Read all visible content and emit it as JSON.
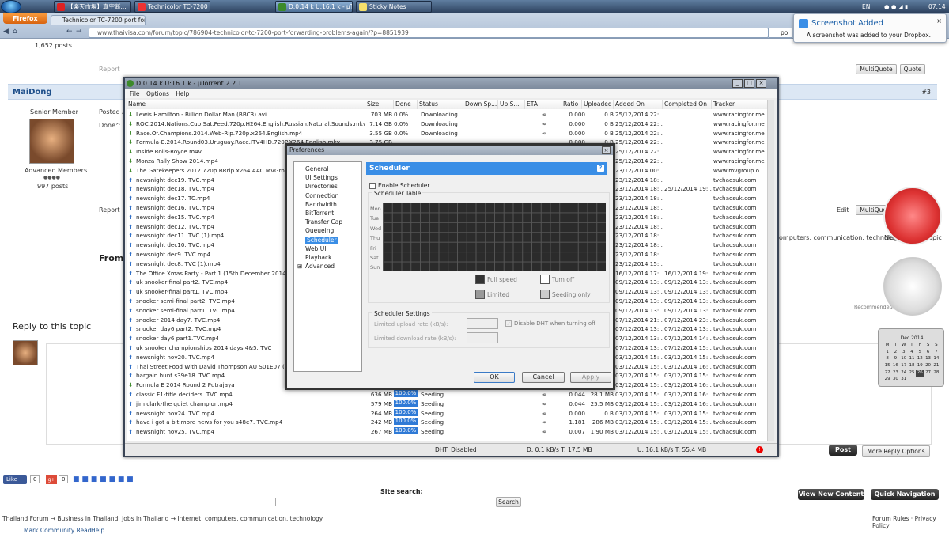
{
  "taskbar": {
    "tabs": [
      "【楽天市場】真空断...",
      "Technicolor TC-7200 ...",
      "D:0.14 k U:16.1 k - µT...",
      "Sticky Notes"
    ],
    "tray_lang": "EN",
    "tray_time": "07:14"
  },
  "browser": {
    "menu_label": "Firefox",
    "tab_title": "Technicolor TC-7200 port for...",
    "url": "www.thaivisa.com/forum/topic/786904-technicolor-tc-7200-port-forwarding-problems-again/?p=8851939",
    "search_hint": "po",
    "toast_title": "Screenshot Added",
    "toast_body": "A screenshot was added to your Dropbox."
  },
  "forum": {
    "posts_count_top": "1,652 posts",
    "report": "Report",
    "multiquote": "MultiQuote",
    "quote": "Quote",
    "author": "MaiDong",
    "post_number": "#3",
    "rank": "Senior Member",
    "posted_label": "Posted A",
    "post_text": "Done^.",
    "member_group": "Advanced Members",
    "posts_count": "997 posts",
    "edit": "Edit",
    "from_label": "From",
    "reply_heading": "Reply to this topic",
    "breadcrumb_right": "omputers, communication, technology",
    "next_unread": "Next Unread Topic",
    "recommended": "Recommended by",
    "post_btn": "Post",
    "more_reply": "More Reply Options",
    "like_label": "Like",
    "like_count": "0",
    "gplus_count": "0",
    "site_search": "Site search:",
    "search_btn": "Search",
    "view_new": "View New Content",
    "quick_nav": "Quick Navigation",
    "bc1": "Thailand Forum",
    "bc2": "Business in Thailand, Jobs in Thailand",
    "bc3": "Internet, computers, communication, technology",
    "forum_rules": "Forum Rules",
    "privacy": "Privacy Policy",
    "mark_read": "Mark Community Read",
    "help": "Help"
  },
  "utorrent": {
    "title": "D:0.14 k U:16.1 k - µTorrent 2.2.1",
    "menu": [
      "File",
      "Options",
      "Help"
    ],
    "columns": [
      "Name",
      "Size",
      "Done",
      "Status",
      "Down Sp...",
      "Up S...",
      "ETA",
      "Ratio",
      "Uploaded",
      "Added On",
      "Completed On",
      "Tracker"
    ],
    "rows": [
      {
        "t": "d",
        "name": "Lewis Hamilton - Billion Dollar Man (BBC3).avi",
        "size": "703 MB",
        "done": "0.0%",
        "status": "Downloading",
        "eta": "∞",
        "ratio": "0.000",
        "up": "0 B",
        "added": "25/12/2014 22:...",
        "comp": "",
        "tracker": "www.racingfor.me"
      },
      {
        "t": "d",
        "name": "ROC.2014.Nations.Cup.Sat.Feed.720p.H264.English.Russian.Natural.Sounds.mkv",
        "size": "7.14 GB",
        "done": "0.0%",
        "status": "Downloading",
        "eta": "∞",
        "ratio": "0.000",
        "up": "0 B",
        "added": "25/12/2014 22:...",
        "comp": "",
        "tracker": "www.racingfor.me"
      },
      {
        "t": "d",
        "name": "Race.Of.Champions.2014.Web-Rip.720p.x264.English.mp4",
        "size": "3.55 GB",
        "done": "0.0%",
        "status": "Downloading",
        "eta": "∞",
        "ratio": "0.000",
        "up": "0 B",
        "added": "25/12/2014 22:...",
        "comp": "",
        "tracker": "www.racingfor.me"
      },
      {
        "t": "d",
        "name": "Formula-E.2014.Round03.Uruguay.Race.ITV4HD.720P.X264.English.mkv",
        "size": "3.75 GB",
        "done": "",
        "status": "",
        "eta": "",
        "ratio": "0.000",
        "up": "0 B",
        "added": "25/12/2014 22:...",
        "comp": "",
        "tracker": "www.racingfor.me"
      },
      {
        "t": "d",
        "name": "Inside Rolls-Royce.m4v",
        "size": "",
        "done": "",
        "status": "",
        "eta": "",
        "ratio": "",
        "up": "",
        "added": "25/12/2014 22:...",
        "comp": "",
        "tracker": "www.racingfor.me"
      },
      {
        "t": "d",
        "name": "Monza Rally Show 2014.mp4",
        "size": "",
        "done": "",
        "status": "",
        "eta": "",
        "ratio": "",
        "up": "",
        "added": "25/12/2014 22:...",
        "comp": "",
        "tracker": "www.racingfor.me"
      },
      {
        "t": "d",
        "name": "The.Gatekeepers.2012.720p.BRrip.x264.AAC.MVGroup.or",
        "size": "",
        "done": "",
        "status": "",
        "eta": "",
        "ratio": "",
        "up": "",
        "added": "23/12/2014 00:...",
        "comp": "",
        "tracker": "www.mvgroup.o..."
      },
      {
        "t": "s",
        "name": "newsnight dec19. TVC.mp4",
        "size": "",
        "done": "",
        "status": "",
        "eta": "",
        "ratio": "",
        "up": "",
        "added": "23/12/2014 18:...",
        "comp": "",
        "tracker": "tvchaosuk.com"
      },
      {
        "t": "s",
        "name": "newsnight dec18. TVC.mp4",
        "size": "",
        "done": "",
        "status": "",
        "eta": "",
        "ratio": "",
        "up": "",
        "added": "23/12/2014 18:...",
        "comp": "25/12/2014 19:...",
        "tracker": "tvchaosuk.com"
      },
      {
        "t": "s",
        "name": "newsnight dec17. TC.mp4",
        "size": "",
        "done": "",
        "status": "",
        "eta": "",
        "ratio": "",
        "up": "",
        "added": "23/12/2014 18:...",
        "comp": "",
        "tracker": "tvchaosuk.com"
      },
      {
        "t": "s",
        "name": "newsnight dec16. TVC.mp4",
        "size": "",
        "done": "",
        "status": "",
        "eta": "",
        "ratio": "",
        "up": "",
        "added": "23/12/2014 18:...",
        "comp": "",
        "tracker": "tvchaosuk.com"
      },
      {
        "t": "s",
        "name": "newsnight dec15. TVC.mp4",
        "size": "",
        "done": "",
        "status": "",
        "eta": "",
        "ratio": "",
        "up": "",
        "added": "23/12/2014 18:...",
        "comp": "",
        "tracker": "tvchaosuk.com"
      },
      {
        "t": "s",
        "name": "newsnight dec12.  TVC.mp4",
        "size": "",
        "done": "",
        "status": "",
        "eta": "",
        "ratio": "",
        "up": "",
        "added": "23/12/2014 18:...",
        "comp": "",
        "tracker": "tvchaosuk.com"
      },
      {
        "t": "s",
        "name": "newsnight dec11. TVC (1).mp4",
        "size": "",
        "done": "",
        "status": "",
        "eta": "",
        "ratio": "",
        "up": "",
        "added": "23/12/2014 18:...",
        "comp": "",
        "tracker": "tvchaosuk.com"
      },
      {
        "t": "s",
        "name": "newsnight dec10. TVC.mp4",
        "size": "",
        "done": "",
        "status": "",
        "eta": "",
        "ratio": "",
        "up": "",
        "added": "23/12/2014 18:...",
        "comp": "",
        "tracker": "tvchaosuk.com"
      },
      {
        "t": "s",
        "name": "newsnight dec9. TVC.mp4",
        "size": "",
        "done": "",
        "status": "",
        "eta": "",
        "ratio": "",
        "up": "",
        "added": "23/12/2014 18:...",
        "comp": "",
        "tracker": "tvchaosuk.com"
      },
      {
        "t": "s",
        "name": "newsnight dec8. TVC (1).mp4",
        "size": "",
        "done": "",
        "status": "",
        "eta": "",
        "ratio": "",
        "up": "",
        "added": "23/12/2014 15:...",
        "comp": "",
        "tracker": "tvchaosuk.com"
      },
      {
        "t": "s",
        "name": "The Office Xmas Party - Part 1 (15th December 2014) [PD",
        "size": "",
        "done": "",
        "status": "",
        "eta": "",
        "ratio": "",
        "up": "",
        "added": "16/12/2014 17:...",
        "comp": "16/12/2014 19:...",
        "tracker": "tvchaosuk.com"
      },
      {
        "t": "s",
        "name": "uk snooker final part2. TVC.mp4",
        "size": "",
        "done": "",
        "status": "",
        "eta": "",
        "ratio": "",
        "up": "",
        "added": "09/12/2014 13:...",
        "comp": "09/12/2014 13:...",
        "tracker": "tvchaosuk.com"
      },
      {
        "t": "s",
        "name": "uk snooker-final part1. TVC.mp4",
        "size": "",
        "done": "",
        "status": "",
        "eta": "",
        "ratio": "",
        "up": "",
        "added": "09/12/2014 13:...",
        "comp": "09/12/2014 13:...",
        "tracker": "tvchaosuk.com"
      },
      {
        "t": "s",
        "name": "snooker semi-final part2. TVC.mp4",
        "size": "",
        "done": "",
        "status": "",
        "eta": "",
        "ratio": "",
        "up": "",
        "added": "09/12/2014 13:...",
        "comp": "09/12/2014 13:...",
        "tracker": "tvchaosuk.com"
      },
      {
        "t": "s",
        "name": "snooker semi-final part1. TVC.mp4",
        "size": "",
        "done": "",
        "status": "",
        "eta": "",
        "ratio": "",
        "up": "",
        "added": "09/12/2014 13:...",
        "comp": "09/12/2014 13:...",
        "tracker": "tvchaosuk.com"
      },
      {
        "t": "s",
        "name": "snooker 2014 day7. TVC.mp4",
        "size": "",
        "done": "",
        "status": "",
        "eta": "",
        "ratio": "",
        "up": "",
        "added": "07/12/2014 21:...",
        "comp": "07/12/2014 23:...",
        "tracker": "tvchaosuk.com"
      },
      {
        "t": "s",
        "name": "snooker day6 part2. TVC.mp4",
        "size": "",
        "done": "",
        "status": "",
        "eta": "",
        "ratio": "",
        "up": "",
        "added": "07/12/2014 13:...",
        "comp": "07/12/2014 13:...",
        "tracker": "tvchaosuk.com"
      },
      {
        "t": "s",
        "name": "snooker day6 part1.TVC.mp4",
        "size": "",
        "done": "",
        "status": "",
        "eta": "",
        "ratio": "",
        "up": "",
        "added": "07/12/2014 13:...",
        "comp": "07/12/2014 14:...",
        "tracker": "tvchaosuk.com"
      },
      {
        "t": "s",
        "name": "uk snooker championships 2014 days 4&5. TVC",
        "size": "",
        "done": "",
        "status": "",
        "eta": "",
        "ratio": "",
        "up": "",
        "added": "07/12/2014 13:...",
        "comp": "07/12/2014 15:...",
        "tracker": "tvchaosuk.com"
      },
      {
        "t": "s",
        "name": "newsnight nov20. TVC.mp4",
        "size": "",
        "done": "",
        "status": "",
        "eta": "",
        "ratio": "",
        "up": "",
        "added": "03/12/2014 15:...",
        "comp": "03/12/2014 15:...",
        "tracker": "tvchaosuk.com"
      },
      {
        "t": "s",
        "name": "Thai Street Food With David Thompson AU S01E07 ( 20 N",
        "size": "",
        "done": "",
        "status": "",
        "eta": "",
        "ratio": "",
        "up": "",
        "added": "03/12/2014 15:...",
        "comp": "03/12/2014 16:...",
        "tracker": "tvchaosuk.com"
      },
      {
        "t": "s",
        "name": "bargain hunt s39e18. TVC.mp4",
        "size": "",
        "done": "",
        "status": "",
        "eta": "",
        "ratio": "",
        "up": "",
        "added": "03/12/2014 15:...",
        "comp": "03/12/2014 15:...",
        "tracker": "tvchaosuk.com"
      },
      {
        "t": "d",
        "name": "Formula E 2014 Round 2 Putrajaya",
        "size": "",
        "done": "",
        "status": "",
        "eta": "",
        "ratio": "",
        "up": "",
        "added": "03/12/2014 15:...",
        "comp": "03/12/2014 16:...",
        "tracker": "tvchaosuk.com"
      },
      {
        "t": "s",
        "name": "classic F1-title deciders. TVC.mp4",
        "size": "636 MB",
        "done": "100.0%",
        "status": "Seeding",
        "eta": "∞",
        "ratio": "0.044",
        "up": "28.1 MB",
        "added": "03/12/2014 15:...",
        "comp": "03/12/2014 16:...",
        "tracker": "tvchaosuk.com"
      },
      {
        "t": "s",
        "name": "jim clark-the quiet champion.mp4",
        "size": "579 MB",
        "done": "100.0%",
        "status": "Seeding",
        "eta": "∞",
        "ratio": "0.044",
        "up": "25.5 MB",
        "added": "03/12/2014 15:...",
        "comp": "03/12/2014 16:...",
        "tracker": "tvchaosuk.com"
      },
      {
        "t": "s",
        "name": "newsnight nov24. TVC.mp4",
        "size": "264 MB",
        "done": "100.0%",
        "status": "Seeding",
        "eta": "∞",
        "ratio": "0.000",
        "up": "0 B",
        "added": "03/12/2014 15:...",
        "comp": "03/12/2014 15:...",
        "tracker": "tvchaosuk.com"
      },
      {
        "t": "s",
        "name": "have i got a bit more news for you s48e7. TVC.mp4",
        "size": "242 MB",
        "done": "100.0%",
        "status": "Seeding",
        "eta": "∞",
        "ratio": "1.181",
        "up": "286 MB",
        "added": "03/12/2014 15:...",
        "comp": "03/12/2014 15:...",
        "tracker": "tvchaosuk.com"
      },
      {
        "t": "s",
        "name": "newsnight nov25. TVC.mp4",
        "size": "267 MB",
        "done": "100.0%",
        "status": "Seeding",
        "eta": "∞",
        "ratio": "0.007",
        "up": "1.90 MB",
        "added": "03/12/2014 15:...",
        "comp": "03/12/2014 15:...",
        "tracker": "tvchaosuk.com"
      }
    ],
    "status_dht": "DHT: Disabled",
    "status_down": "D: 0.1 kB/s T: 17.5 MB",
    "status_up": "U: 16.1 kB/s T: 55.4 MB"
  },
  "preferences": {
    "title": "Preferences",
    "tree": [
      "General",
      "UI Settings",
      "Directories",
      "Connection",
      "Bandwidth",
      "BitTorrent",
      "Transfer Cap",
      "Queueing",
      "Scheduler",
      "Web UI",
      "Playback",
      "Advanced"
    ],
    "selected": "Scheduler",
    "header": "Scheduler",
    "help": "?",
    "enable_label": "Enable Scheduler",
    "table_label": "Scheduler Table",
    "days": [
      "Mon",
      "Tue",
      "Wed",
      "Thu",
      "Fri",
      "Sat",
      "Sun"
    ],
    "legend": [
      "Full speed",
      "Turn off",
      "Limited",
      "Seeding only"
    ],
    "settings_label": "Scheduler Settings",
    "upload_label": "Limited upload rate (kB/s):",
    "download_label": "Limited download rate (kB/s):",
    "dht_label": "Disable DHT when turning off",
    "ok": "OK",
    "cancel": "Cancel",
    "apply": "Apply"
  },
  "calendar": {
    "month": "Dec 2014",
    "weekdays": [
      "M",
      "T",
      "W",
      "T",
      "F",
      "S",
      "S"
    ],
    "days": [
      "1",
      "2",
      "3",
      "4",
      "5",
      "6",
      "7",
      "8",
      "9",
      "10",
      "11",
      "12",
      "13",
      "14",
      "15",
      "16",
      "17",
      "18",
      "19",
      "20",
      "21",
      "22",
      "23",
      "24",
      "25",
      "26",
      "27",
      "28",
      "29",
      "30",
      "31"
    ],
    "today": "26"
  },
  "colors": {
    "accent": "#3a8ee6",
    "download_icon": "#3c8a2a",
    "seed_icon": "#2a6bc6",
    "taskbar": "#2b3f5c"
  }
}
